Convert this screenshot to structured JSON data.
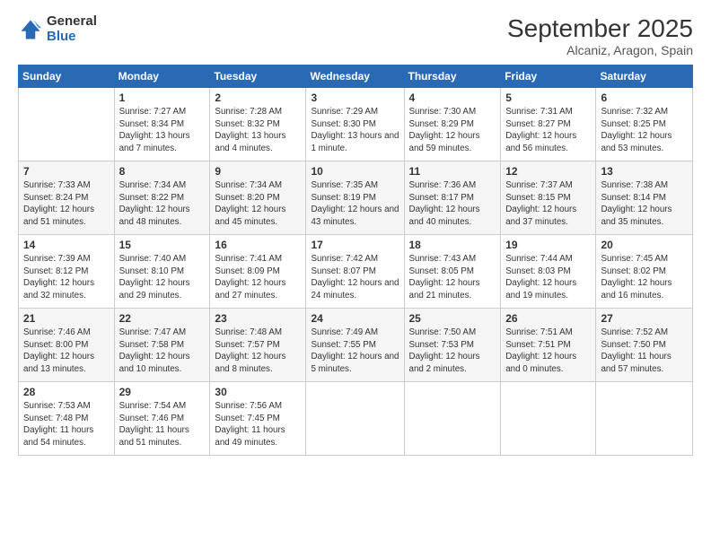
{
  "logo": {
    "general": "General",
    "blue": "Blue"
  },
  "title": "September 2025",
  "location": "Alcaniz, Aragon, Spain",
  "days_of_week": [
    "Sunday",
    "Monday",
    "Tuesday",
    "Wednesday",
    "Thursday",
    "Friday",
    "Saturday"
  ],
  "weeks": [
    [
      {
        "day": "",
        "sunrise": "",
        "sunset": "",
        "daylight": ""
      },
      {
        "day": "1",
        "sunrise": "Sunrise: 7:27 AM",
        "sunset": "Sunset: 8:34 PM",
        "daylight": "Daylight: 13 hours and 7 minutes."
      },
      {
        "day": "2",
        "sunrise": "Sunrise: 7:28 AM",
        "sunset": "Sunset: 8:32 PM",
        "daylight": "Daylight: 13 hours and 4 minutes."
      },
      {
        "day": "3",
        "sunrise": "Sunrise: 7:29 AM",
        "sunset": "Sunset: 8:30 PM",
        "daylight": "Daylight: 13 hours and 1 minute."
      },
      {
        "day": "4",
        "sunrise": "Sunrise: 7:30 AM",
        "sunset": "Sunset: 8:29 PM",
        "daylight": "Daylight: 12 hours and 59 minutes."
      },
      {
        "day": "5",
        "sunrise": "Sunrise: 7:31 AM",
        "sunset": "Sunset: 8:27 PM",
        "daylight": "Daylight: 12 hours and 56 minutes."
      },
      {
        "day": "6",
        "sunrise": "Sunrise: 7:32 AM",
        "sunset": "Sunset: 8:25 PM",
        "daylight": "Daylight: 12 hours and 53 minutes."
      }
    ],
    [
      {
        "day": "7",
        "sunrise": "Sunrise: 7:33 AM",
        "sunset": "Sunset: 8:24 PM",
        "daylight": "Daylight: 12 hours and 51 minutes."
      },
      {
        "day": "8",
        "sunrise": "Sunrise: 7:34 AM",
        "sunset": "Sunset: 8:22 PM",
        "daylight": "Daylight: 12 hours and 48 minutes."
      },
      {
        "day": "9",
        "sunrise": "Sunrise: 7:34 AM",
        "sunset": "Sunset: 8:20 PM",
        "daylight": "Daylight: 12 hours and 45 minutes."
      },
      {
        "day": "10",
        "sunrise": "Sunrise: 7:35 AM",
        "sunset": "Sunset: 8:19 PM",
        "daylight": "Daylight: 12 hours and 43 minutes."
      },
      {
        "day": "11",
        "sunrise": "Sunrise: 7:36 AM",
        "sunset": "Sunset: 8:17 PM",
        "daylight": "Daylight: 12 hours and 40 minutes."
      },
      {
        "day": "12",
        "sunrise": "Sunrise: 7:37 AM",
        "sunset": "Sunset: 8:15 PM",
        "daylight": "Daylight: 12 hours and 37 minutes."
      },
      {
        "day": "13",
        "sunrise": "Sunrise: 7:38 AM",
        "sunset": "Sunset: 8:14 PM",
        "daylight": "Daylight: 12 hours and 35 minutes."
      }
    ],
    [
      {
        "day": "14",
        "sunrise": "Sunrise: 7:39 AM",
        "sunset": "Sunset: 8:12 PM",
        "daylight": "Daylight: 12 hours and 32 minutes."
      },
      {
        "day": "15",
        "sunrise": "Sunrise: 7:40 AM",
        "sunset": "Sunset: 8:10 PM",
        "daylight": "Daylight: 12 hours and 29 minutes."
      },
      {
        "day": "16",
        "sunrise": "Sunrise: 7:41 AM",
        "sunset": "Sunset: 8:09 PM",
        "daylight": "Daylight: 12 hours and 27 minutes."
      },
      {
        "day": "17",
        "sunrise": "Sunrise: 7:42 AM",
        "sunset": "Sunset: 8:07 PM",
        "daylight": "Daylight: 12 hours and 24 minutes."
      },
      {
        "day": "18",
        "sunrise": "Sunrise: 7:43 AM",
        "sunset": "Sunset: 8:05 PM",
        "daylight": "Daylight: 12 hours and 21 minutes."
      },
      {
        "day": "19",
        "sunrise": "Sunrise: 7:44 AM",
        "sunset": "Sunset: 8:03 PM",
        "daylight": "Daylight: 12 hours and 19 minutes."
      },
      {
        "day": "20",
        "sunrise": "Sunrise: 7:45 AM",
        "sunset": "Sunset: 8:02 PM",
        "daylight": "Daylight: 12 hours and 16 minutes."
      }
    ],
    [
      {
        "day": "21",
        "sunrise": "Sunrise: 7:46 AM",
        "sunset": "Sunset: 8:00 PM",
        "daylight": "Daylight: 12 hours and 13 minutes."
      },
      {
        "day": "22",
        "sunrise": "Sunrise: 7:47 AM",
        "sunset": "Sunset: 7:58 PM",
        "daylight": "Daylight: 12 hours and 10 minutes."
      },
      {
        "day": "23",
        "sunrise": "Sunrise: 7:48 AM",
        "sunset": "Sunset: 7:57 PM",
        "daylight": "Daylight: 12 hours and 8 minutes."
      },
      {
        "day": "24",
        "sunrise": "Sunrise: 7:49 AM",
        "sunset": "Sunset: 7:55 PM",
        "daylight": "Daylight: 12 hours and 5 minutes."
      },
      {
        "day": "25",
        "sunrise": "Sunrise: 7:50 AM",
        "sunset": "Sunset: 7:53 PM",
        "daylight": "Daylight: 12 hours and 2 minutes."
      },
      {
        "day": "26",
        "sunrise": "Sunrise: 7:51 AM",
        "sunset": "Sunset: 7:51 PM",
        "daylight": "Daylight: 12 hours and 0 minutes."
      },
      {
        "day": "27",
        "sunrise": "Sunrise: 7:52 AM",
        "sunset": "Sunset: 7:50 PM",
        "daylight": "Daylight: 11 hours and 57 minutes."
      }
    ],
    [
      {
        "day": "28",
        "sunrise": "Sunrise: 7:53 AM",
        "sunset": "Sunset: 7:48 PM",
        "daylight": "Daylight: 11 hours and 54 minutes."
      },
      {
        "day": "29",
        "sunrise": "Sunrise: 7:54 AM",
        "sunset": "Sunset: 7:46 PM",
        "daylight": "Daylight: 11 hours and 51 minutes."
      },
      {
        "day": "30",
        "sunrise": "Sunrise: 7:56 AM",
        "sunset": "Sunset: 7:45 PM",
        "daylight": "Daylight: 11 hours and 49 minutes."
      },
      {
        "day": "",
        "sunrise": "",
        "sunset": "",
        "daylight": ""
      },
      {
        "day": "",
        "sunrise": "",
        "sunset": "",
        "daylight": ""
      },
      {
        "day": "",
        "sunrise": "",
        "sunset": "",
        "daylight": ""
      },
      {
        "day": "",
        "sunrise": "",
        "sunset": "",
        "daylight": ""
      }
    ]
  ]
}
